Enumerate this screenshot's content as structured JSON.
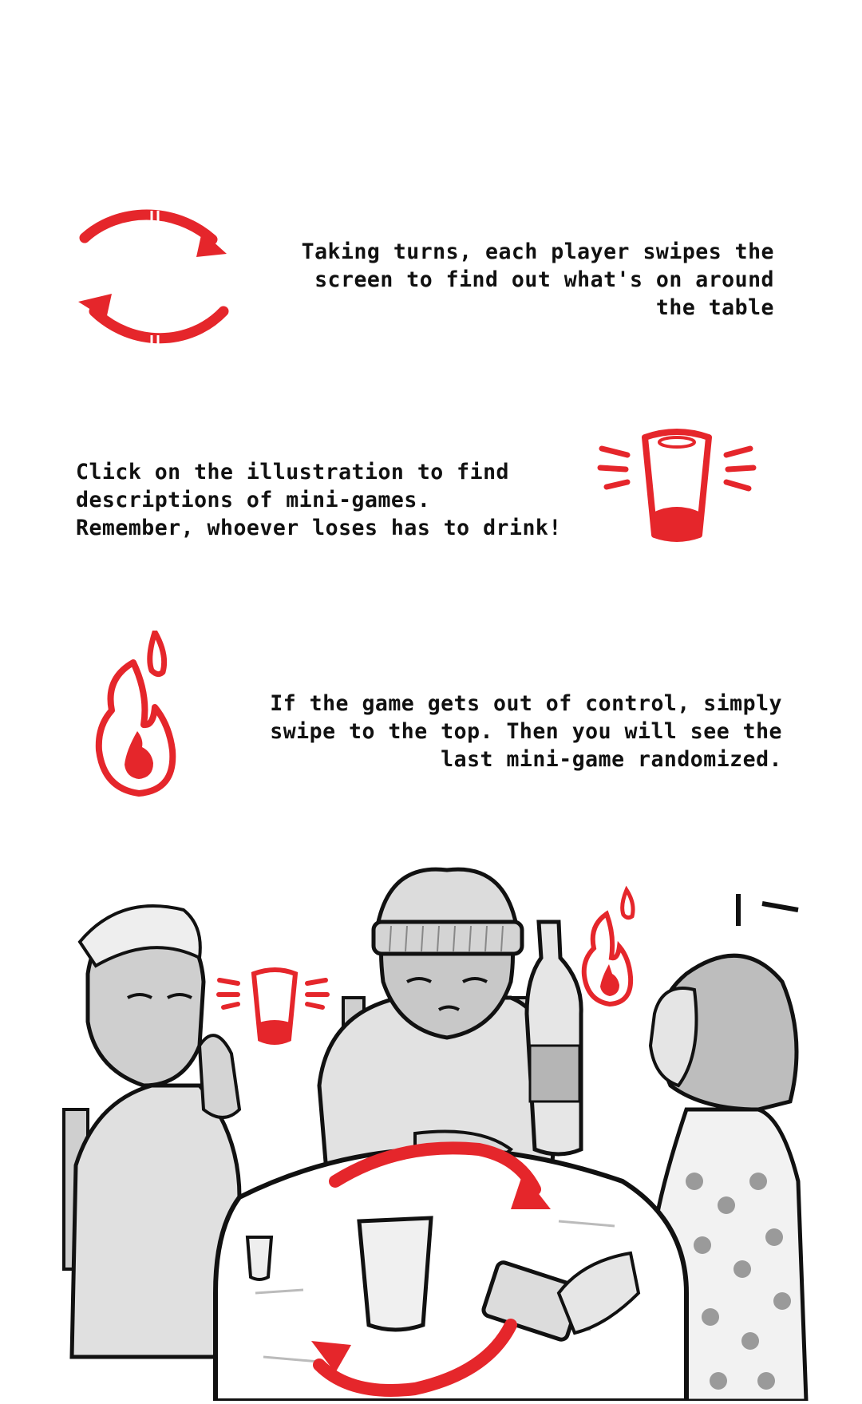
{
  "instructions": [
    {
      "icon": "rotate-arrows-icon",
      "text": "Taking turns, each player swipes the\nscreen to find out what's on around\nthe table"
    },
    {
      "icon": "shot-glass-icon",
      "text": "Click on the illustration to find\ndescriptions of mini-games.\nRemember, whoever loses has to drink!"
    },
    {
      "icon": "flame-icon",
      "text": "If the game gets out of control, simply\nswipe to the top. Then you will see the\nlast mini-game randomized."
    }
  ],
  "colors": {
    "accent": "#e5262b",
    "ink": "#111111",
    "background": "#ffffff",
    "shade": "#9a9a9a"
  }
}
